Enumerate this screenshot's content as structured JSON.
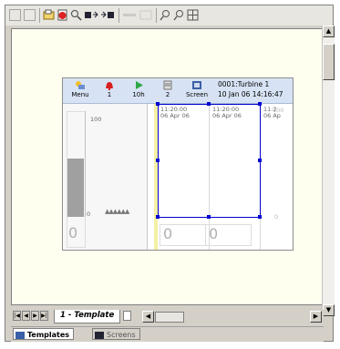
{
  "toolbar": {
    "icons": [
      "window-icon",
      "page-icon",
      "open-icon",
      "delete-icon",
      "zoom-icon",
      "insert-icon",
      "move-icon",
      "disabled-icon",
      "disabled-icon",
      "zoom-in-icon",
      "zoom-out-icon",
      "grid-icon"
    ]
  },
  "recorder": {
    "buttons": [
      {
        "icon": "menu-icon",
        "label": "Menu"
      },
      {
        "icon": "alarm-icon",
        "label": "1"
      },
      {
        "icon": "play-icon",
        "label": "10h"
      },
      {
        "icon": "print-icon",
        "label": "2"
      },
      {
        "icon": "screen-icon",
        "label": "Screen"
      }
    ],
    "id_text": "0001:Turbine 1",
    "datetime": "10 Jan 06  14:16:47",
    "left_panel": {
      "scale_top": "100",
      "scale_bottom": "0",
      "value": "0"
    },
    "chart": {
      "time_labels": [
        {
          "time": "11:20:00",
          "date": "06 Apr 06"
        },
        {
          "time": "11:20:00",
          "date": "06 Apr 06"
        },
        {
          "time": "11:2",
          "date": "06 Ap"
        }
      ],
      "scale_top": "100",
      "scale_bottom": "0",
      "values": [
        "0",
        "0"
      ]
    }
  },
  "tabs": {
    "active": "1 - Template"
  },
  "bottom_tabs": [
    "Templates",
    "Screens"
  ],
  "colors": {
    "canvas": "#fffff0",
    "header": "#d7e3f4",
    "handles": "#0000d0"
  }
}
